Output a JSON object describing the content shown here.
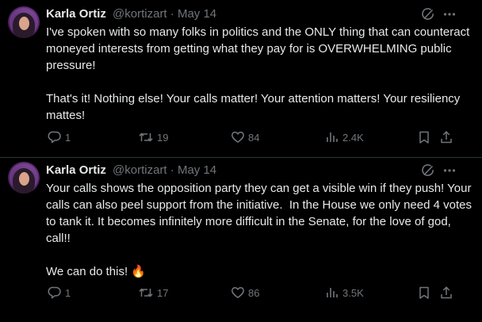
{
  "tweets": [
    {
      "author_name": "Karla Ortiz",
      "handle": "@kortizart",
      "separator": "·",
      "date": "May 14",
      "text": "I've spoken with so many folks in politics and the ONLY thing that can counteract moneyed interests from getting what they pay for is OVERWHELMING public pressure!\n\nThat's it! Nothing else! Your calls matter! Your attention matters! Your resiliency mattes!",
      "emoji": "",
      "stats": {
        "replies": "1",
        "reposts": "19",
        "likes": "84",
        "views": "2.4K"
      }
    },
    {
      "author_name": "Karla Ortiz",
      "handle": "@kortizart",
      "separator": "·",
      "date": "May 14",
      "text": "Your calls shows the opposition party they can get a visible win if they push! Your calls can also peel support from the initiative.  In the House we only need 4 votes to tank it. It becomes infinitely more difficult in the Senate, for the love of god, call!!\n\nWe can do this! ",
      "emoji": "🔥",
      "stats": {
        "replies": "1",
        "reposts": "17",
        "likes": "86",
        "views": "3.5K"
      }
    }
  ],
  "icons": {
    "avatar": "avatar",
    "grok": "grok-icon",
    "more": "more-icon",
    "reply": "reply-icon",
    "repost": "repost-icon",
    "like": "like-icon",
    "views": "views-icon",
    "bookmark": "bookmark-icon",
    "share": "share-icon"
  },
  "colors": {
    "background": "#000000",
    "text": "#e7e9ea",
    "secondary": "#71767b",
    "divider": "#2f3336"
  }
}
